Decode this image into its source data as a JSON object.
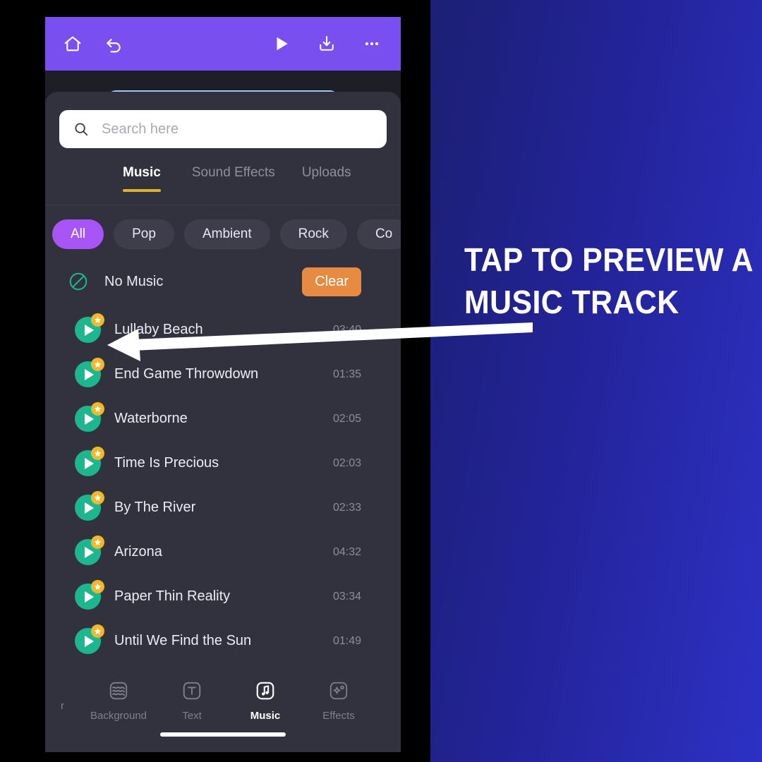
{
  "promo": {
    "line1": "TAP TO PREVIEW A",
    "line2": "MUSIC TRACK",
    "text_color": "#ffffff",
    "bg_gradient_from": "#1c1f73",
    "bg_gradient_to": "#2d31c4"
  },
  "toolbar": {
    "accent": "#7a4ff0",
    "home_icon": "home-icon",
    "undo_icon": "undo-icon",
    "play_icon": "play-icon",
    "download_icon": "download-icon",
    "more_icon": "more-options-icon"
  },
  "search": {
    "placeholder": "Search here",
    "value": "",
    "icon": "search-icon"
  },
  "tabs": [
    {
      "label": "Music",
      "active": true
    },
    {
      "label": "Sound Effects",
      "active": false
    },
    {
      "label": "Uploads",
      "active": false
    }
  ],
  "tab_underline_color": "#e0b02e",
  "chips": [
    {
      "label": "All",
      "active": true
    },
    {
      "label": "Pop",
      "active": false
    },
    {
      "label": "Ambient",
      "active": false
    },
    {
      "label": "Rock",
      "active": false
    },
    {
      "label": "Co",
      "active": false
    }
  ],
  "chip_active_color": "#a855f7",
  "no_music": {
    "label": "No Music",
    "icon": "no-music-icon",
    "clear_label": "Clear",
    "clear_color": "#e88b42"
  },
  "tracks": [
    {
      "title": "Lullaby Beach",
      "duration": "03:40"
    },
    {
      "title": "End Game Throwdown",
      "duration": "01:35"
    },
    {
      "title": "Waterborne",
      "duration": "02:05"
    },
    {
      "title": "Time Is Precious",
      "duration": "02:03"
    },
    {
      "title": "By The River",
      "duration": "02:33"
    },
    {
      "title": "Arizona",
      "duration": "04:32"
    },
    {
      "title": "Paper Thin Reality",
      "duration": "03:34"
    },
    {
      "title": "Until We Find the Sun",
      "duration": "01:49"
    }
  ],
  "track_art": {
    "disc_color": "#1cb68f",
    "star_color": "#f1b82c"
  },
  "bottom_nav": {
    "partial_label": "r",
    "items": [
      {
        "label": "Background",
        "icon": "layers-icon",
        "active": false
      },
      {
        "label": "Text",
        "icon": "text-icon",
        "active": false
      },
      {
        "label": "Music",
        "icon": "music-note-icon",
        "active": true
      },
      {
        "label": "Effects",
        "icon": "sparkle-icon",
        "active": false
      }
    ]
  }
}
